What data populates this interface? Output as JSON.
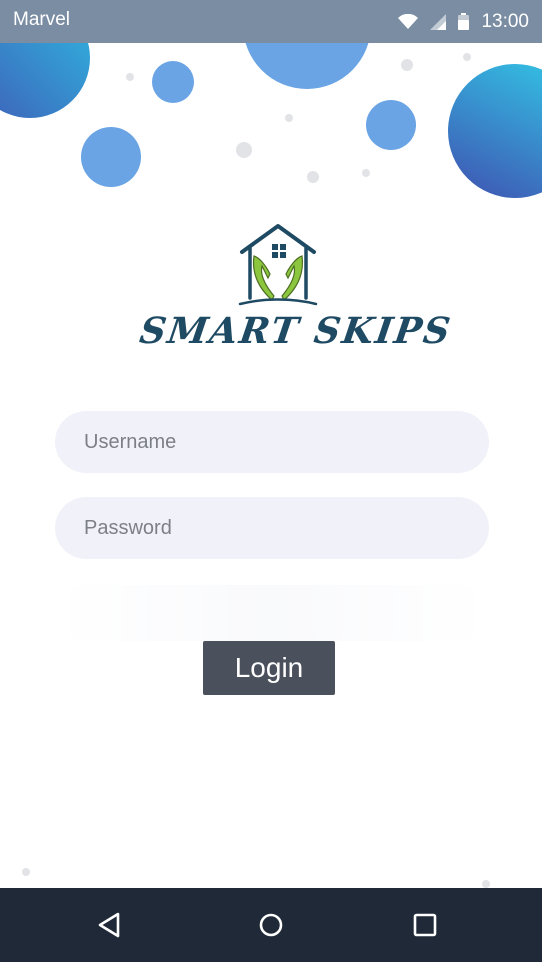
{
  "status_bar": {
    "app_name": "Marvel",
    "time": "13:00",
    "icons": [
      "wifi-icon",
      "signal-icon",
      "battery-icon"
    ]
  },
  "logo": {
    "text": "SMART SKIPS",
    "icon": "house-hands-icon"
  },
  "form": {
    "username_placeholder": "Username",
    "password_placeholder": "Password",
    "login_label": "Login"
  },
  "nav_bar": {
    "icons": [
      "back-icon",
      "home-icon",
      "recents-icon"
    ]
  },
  "colors": {
    "status_bar": "#7a8da3",
    "bubble_blue": "#6aa4e4",
    "bubble_gradient_start": "#2fb7e0",
    "bubble_gradient_end": "#3f5fb8",
    "input_bg": "#f1f2f9",
    "login_bg": "#4a515c",
    "nav_bar": "#1f2937",
    "logo_text": "#1f4a63",
    "logo_green": "#8cc63f"
  }
}
